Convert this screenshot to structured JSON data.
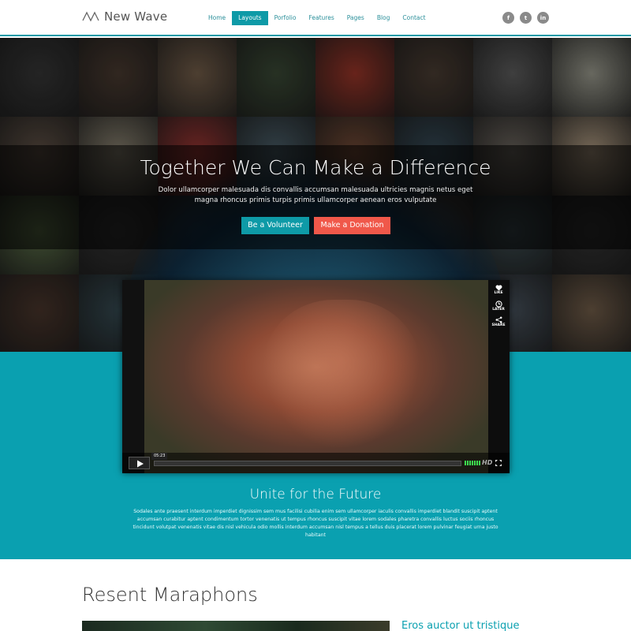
{
  "header": {
    "logo_text": "New Wave",
    "nav": [
      {
        "label": "Home",
        "active": false
      },
      {
        "label": "Layouts",
        "active": true
      },
      {
        "label": "Porfolio",
        "active": false
      },
      {
        "label": "Features",
        "active": false
      },
      {
        "label": "Pages",
        "active": false
      },
      {
        "label": "Blog",
        "active": false
      },
      {
        "label": "Contact",
        "active": false
      }
    ],
    "social": [
      {
        "label": "f",
        "icon": "facebook-icon"
      },
      {
        "label": "t",
        "icon": "twitter-icon"
      },
      {
        "label": "in",
        "icon": "linkedin-icon"
      }
    ]
  },
  "hero": {
    "title": "Together We Can Make a Difference",
    "text": "Dolor ullamcorper malesuada dis convallis accumsan malesuada ultricies magnis netus eget magna rhoncus primis turpis primis ullamcorper aenean eros vulputate",
    "volunteer_label": "Be a Volunteer",
    "donate_label": "Make a Donation"
  },
  "video": {
    "time": "05:23",
    "hd_label": "HD",
    "side_buttons": [
      {
        "label": "LIKE",
        "icon": "heart-icon"
      },
      {
        "label": "LATER",
        "icon": "clock-icon"
      },
      {
        "label": "SHARE",
        "icon": "share-icon"
      }
    ]
  },
  "unite": {
    "title": "Unite for the Future",
    "text": "Sodales ante praesent interdum imperdiet dignissim sem mus facilisi cubilia enim sem ullamcorper iaculis convallis imperdiet blandit suscipit aptent accumsan curabitur aptent condimentum tortor venenatis ut tempus rhoncus suscipit vitae lorem sodales pharetra convallis luctus sociis rhoncus tincidunt volutpat venenatis vitae dis nisl vehicula odio mollis interdum accumsan nisl tempus a tellus duis placerat lorem pulvinar feugiat urna justo habitant"
  },
  "recent": {
    "title": "Resent Maraphons",
    "link": "Eros auctor ut tristique"
  },
  "colors": {
    "accent": "#0aa0b0",
    "donate": "#f0584a"
  }
}
